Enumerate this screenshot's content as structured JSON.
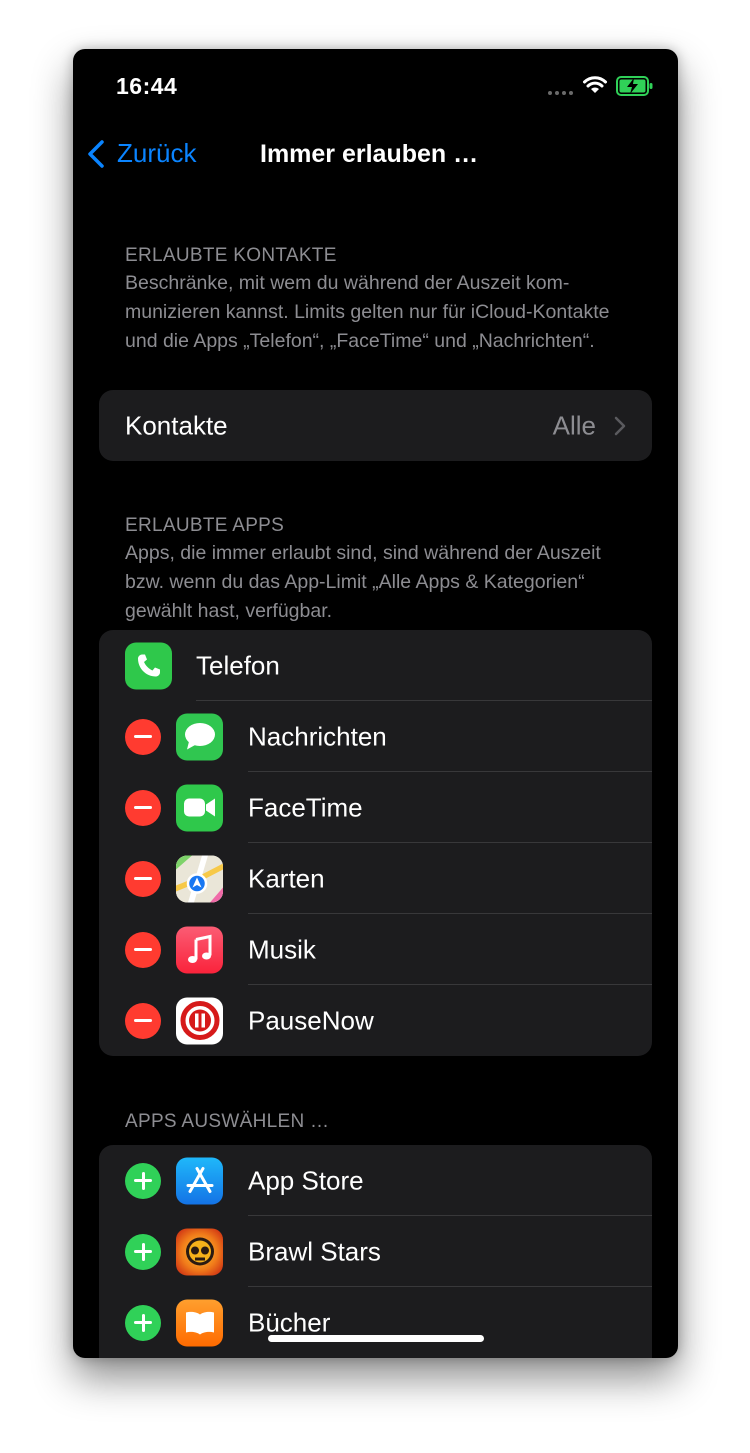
{
  "status": {
    "time": "16:44"
  },
  "nav": {
    "back_label": "Zurück",
    "title": "Immer erlauben …"
  },
  "contacts_section": {
    "header": "ERLAUBTE KONTAKTE",
    "description": "Beschränke, mit wem du während der Auszeit kom­munizieren kannst. Limits gelten nur für iCloud-Kontakte und die Apps „Telefon“, „FaceTime“ und „Nachrichten“.",
    "row_label": "Kontakte",
    "row_value": "Alle"
  },
  "apps_section": {
    "header": "ERLAUBTE APPS",
    "description": "Apps, die immer erlaubt sind, sind während der Auszeit bzw. wenn du das App-Limit „Alle Apps & Kategorien“ gewählt hast, verfügbar.",
    "apps": [
      {
        "label": "Telefon",
        "icon": "phone-icon"
      },
      {
        "label": "Nachrichten",
        "icon": "messages-icon"
      },
      {
        "label": "FaceTime",
        "icon": "facetime-icon"
      },
      {
        "label": "Karten",
        "icon": "maps-icon"
      },
      {
        "label": "Musik",
        "icon": "music-icon"
      },
      {
        "label": "PauseNow",
        "icon": "pausenow-icon"
      }
    ]
  },
  "choose_section": {
    "header": "APPS AUSWÄHLEN …",
    "apps": [
      {
        "label": "App Store",
        "icon": "app-store-icon"
      },
      {
        "label": "Brawl Stars",
        "icon": "brawl-stars-icon"
      },
      {
        "label": "Bücher",
        "icon": "books-icon"
      }
    ]
  },
  "colors": {
    "accent": "#0a84ff",
    "remove": "#ff3b30",
    "add": "#30d158",
    "background": "#000000",
    "card": "#1c1c1e"
  }
}
